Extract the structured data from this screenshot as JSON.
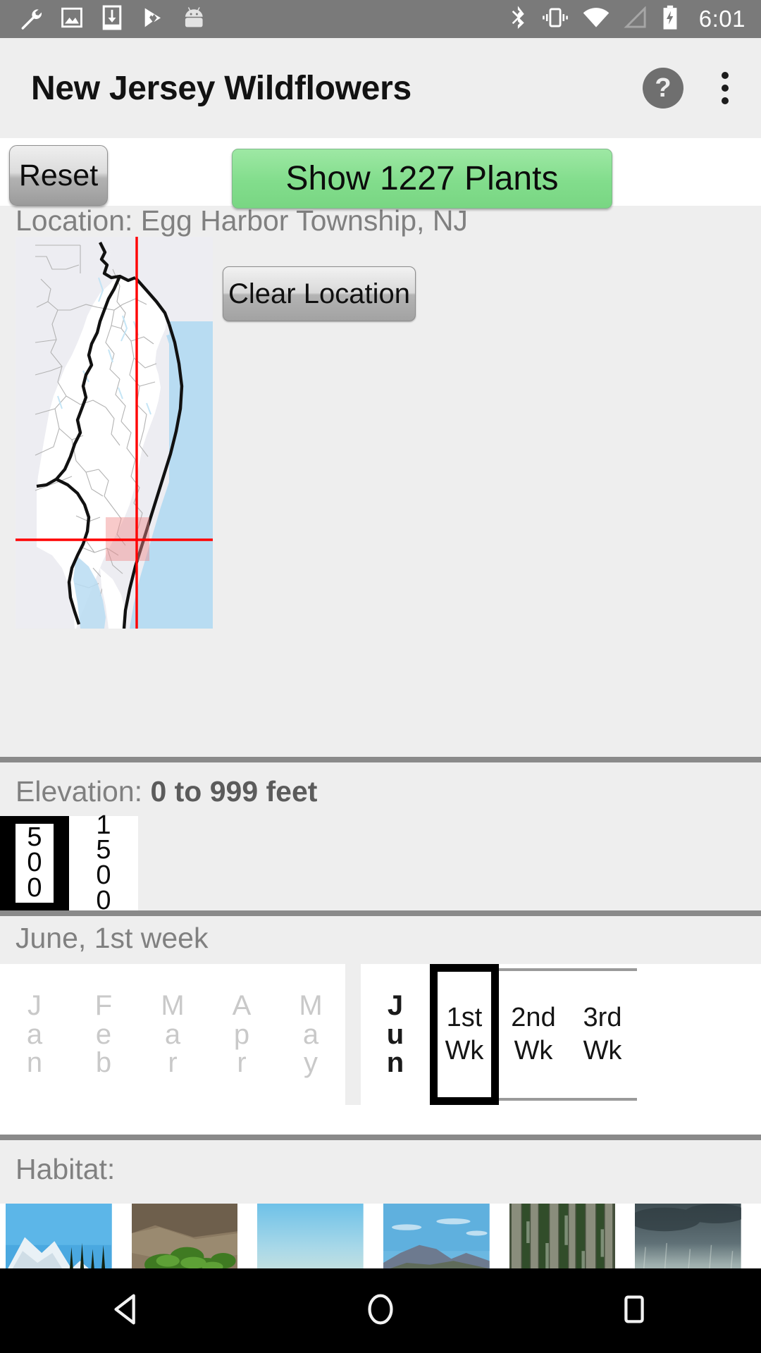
{
  "statusbar": {
    "time": "6:01",
    "left_icons": [
      "wrench-icon",
      "image-icon",
      "download-to-device-icon",
      "play-store-icon",
      "android-head-icon"
    ],
    "right_icons": [
      "bluetooth-icon",
      "vibrate-icon",
      "wifi-icon",
      "cell-signal-icon",
      "battery-charging-icon"
    ]
  },
  "appbar": {
    "title": "New Jersey Wildflowers",
    "help_label": "?",
    "overflow_label": "overflow-menu"
  },
  "toolbar": {
    "reset_label": "Reset",
    "show_label": "Show 1227 Plants",
    "plant_count": 1227,
    "show_button_color": "#82dd8c"
  },
  "location": {
    "label": "Location: Egg Harbor Township, NJ",
    "place": "Egg Harbor Township, NJ",
    "clear_label": "Clear Location",
    "map_name": "new-jersey-map",
    "crosshair_color": "#ff0000",
    "highlight_color": "#f5a8a8",
    "water_color": "#b8dcf2",
    "land_color": "#ffffff",
    "outside_color": "#ededf2"
  },
  "elevation": {
    "label_prefix": "Elevation: ",
    "label_value": "0 to 999 feet",
    "range_min": 0,
    "range_max": 999,
    "cells": [
      {
        "value": "500",
        "digits": [
          "5",
          "0",
          "0"
        ],
        "selected": true
      },
      {
        "value": "1500",
        "digits": [
          "1",
          "5",
          "0",
          "0"
        ],
        "selected": false
      }
    ]
  },
  "month": {
    "label": "June, 1st week",
    "months": [
      {
        "abbr": "Jan",
        "letters": [
          "J",
          "a",
          "n"
        ],
        "active": false
      },
      {
        "abbr": "Feb",
        "letters": [
          "F",
          "e",
          "b"
        ],
        "active": false
      },
      {
        "abbr": "Mar",
        "letters": [
          "M",
          "a",
          "r"
        ],
        "active": false
      },
      {
        "abbr": "Apr",
        "letters": [
          "A",
          "p",
          "r"
        ],
        "active": false
      },
      {
        "abbr": "May",
        "letters": [
          "M",
          "a",
          "y"
        ],
        "active": false
      }
    ],
    "selected_month": {
      "abbr": "Jun",
      "letters": [
        "J",
        "u",
        "n"
      ],
      "active": true
    },
    "weeks": [
      {
        "ord": "1st",
        "unit": "Wk",
        "selected": true
      },
      {
        "ord": "2nd",
        "unit": "Wk",
        "selected": false
      },
      {
        "ord": "3rd",
        "unit": "Wk",
        "selected": false
      }
    ]
  },
  "habitat": {
    "label": "Habitat:",
    "items": [
      {
        "name": "alpine-mountain-habitat"
      },
      {
        "name": "rocky-fern-habitat"
      },
      {
        "name": "hazy-sky-habitat"
      },
      {
        "name": "dry-hills-habitat"
      },
      {
        "name": "dense-forest-habitat"
      },
      {
        "name": "stormy-coast-habitat"
      }
    ]
  },
  "navbar": {
    "back_label": "back-button",
    "home_label": "home-button",
    "recents_label": "recents-button"
  }
}
